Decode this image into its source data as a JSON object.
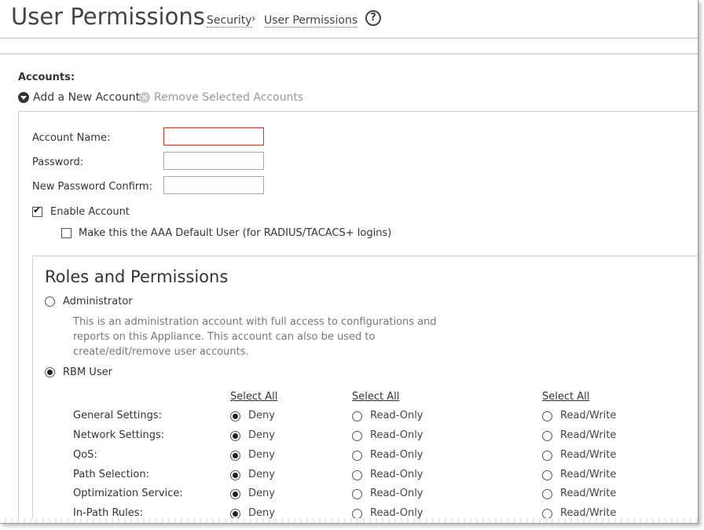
{
  "page": {
    "title": "User Permissions"
  },
  "breadcrumb": {
    "parent": "Security",
    "separator": "›",
    "current": "User Permissions"
  },
  "help_icon": "?",
  "accounts": {
    "label": "Accounts:",
    "add_label": "Add a New Account",
    "remove_label": "Remove Selected Accounts"
  },
  "form": {
    "account_name_label": "Account Name:",
    "account_name_value": "",
    "password_label": "Password:",
    "password_value": "",
    "confirm_label": "New Password Confirm:",
    "confirm_value": "",
    "enable_account_label": "Enable Account",
    "enable_account_checked": true,
    "aaa_default_label": "Make this the AAA Default User (for RADIUS/TACACS+ logins)",
    "aaa_default_checked": false
  },
  "roles": {
    "title": "Roles and Permissions",
    "administrator_label": "Administrator",
    "administrator_desc": "This is an administration account with full access to configurations and reports on this Appliance. This account can also be used to create/edit/remove user accounts.",
    "rbm_label": "RBM User",
    "selected": "RBM User"
  },
  "permissions": {
    "select_all": [
      "Select All",
      "Select All",
      "Select All"
    ],
    "options": [
      "Deny",
      "Read-Only",
      "Read/Write"
    ],
    "rows": [
      {
        "name": "General Settings:",
        "value": "Deny"
      },
      {
        "name": "Network Settings:",
        "value": "Deny"
      },
      {
        "name": "QoS:",
        "value": "Deny"
      },
      {
        "name": "Path Selection:",
        "value": "Deny"
      },
      {
        "name": "Optimization Service:",
        "value": "Deny"
      },
      {
        "name": "In-Path Rules:",
        "value": "Deny"
      }
    ]
  }
}
